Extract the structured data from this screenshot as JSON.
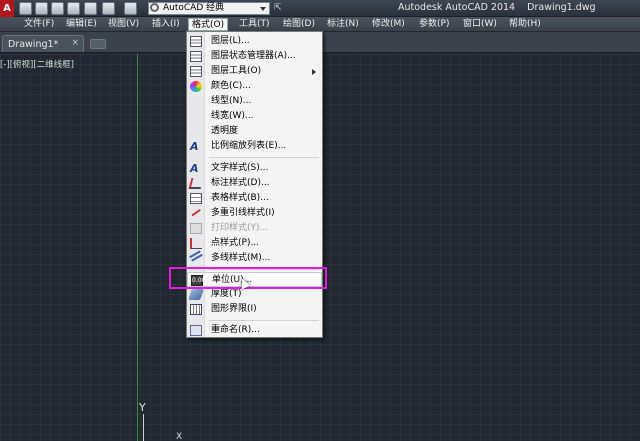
{
  "titlebar": {
    "workspace": "AutoCAD 经典",
    "title": "Autodesk AutoCAD 2014    Drawing1.dwg",
    "logo_letter": "A",
    "quick_more": "⇱"
  },
  "menubar": {
    "items": [
      "文件(F)",
      "编辑(E)",
      "视图(V)",
      "插入(I)",
      "格式(O)",
      "工具(T)",
      "绘图(D)",
      "标注(N)",
      "修改(M)",
      "参数(P)",
      "窗口(W)",
      "帮助(H)"
    ],
    "active_index": 4
  },
  "tabs": {
    "drawing": "Drawing1*",
    "close": "×"
  },
  "canvas": {
    "view_label": "[-][俯视][二维线框]",
    "y_axis_label": "Y",
    "x_axis_label": "X"
  },
  "format_menu": {
    "items": [
      {
        "label": "图层(L)...",
        "icon": "layer-icon"
      },
      {
        "label": "图层状态管理器(A)...",
        "icon": "layer-state-icon"
      },
      {
        "label": "图层工具(O)",
        "icon": "layer-tools-icon",
        "submenu": true
      },
      {
        "label": "颜色(C)...",
        "icon": "color-icon"
      },
      {
        "label": "线型(N)...",
        "icon": ""
      },
      {
        "label": "线宽(W)...",
        "icon": ""
      },
      {
        "label": "透明度",
        "icon": ""
      },
      {
        "label": "比例缩放列表(E)...",
        "icon": "scale-list-icon"
      },
      {
        "label": "文字样式(S)...",
        "icon": "text-style-icon"
      },
      {
        "label": "标注样式(D)...",
        "icon": "dim-style-icon"
      },
      {
        "label": "表格样式(B)...",
        "icon": "table-style-icon"
      },
      {
        "label": "多重引线样式(I)",
        "icon": "mleader-style-icon"
      },
      {
        "label": "打印样式(Y)...",
        "icon": "plot-style-icon",
        "disabled": true
      },
      {
        "label": "点样式(P)...",
        "icon": "point-style-icon"
      },
      {
        "label": "多线样式(M)...",
        "icon": "mline-style-icon"
      },
      {
        "label": "单位(U)...",
        "icon": "units-icon",
        "hover": true
      },
      {
        "label": "厚度(T)",
        "icon": "thickness-icon"
      },
      {
        "label": "图形界限(I)",
        "icon": "limits-icon"
      },
      {
        "label": "重命名(R)...",
        "icon": "rename-icon"
      }
    ],
    "units_icon_text": "0.00"
  },
  "colors": {
    "highlight": "#e01ce0",
    "canvas": "#212830",
    "menu_bg": "#f4f4f4"
  }
}
